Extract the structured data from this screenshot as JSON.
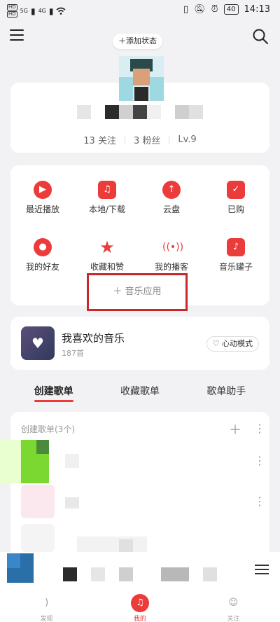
{
  "status_bar": {
    "hd1": "HD",
    "hd2": "HD",
    "sig1": "5G",
    "sig2": "4G",
    "battery": "40",
    "time": "14:13"
  },
  "header": {
    "add_status_label": "＋添加状态"
  },
  "profile": {
    "following": "13 关注",
    "followers": "3 粉丝",
    "level": "Lv.9"
  },
  "apps": {
    "row1": [
      {
        "label": "最近播放",
        "icon": "play-icon"
      },
      {
        "label": "本地/下载",
        "icon": "music-folder-icon"
      },
      {
        "label": "云盘",
        "icon": "cloud-upload-icon"
      },
      {
        "label": "已购",
        "icon": "bag-check-icon"
      }
    ],
    "row2": [
      {
        "label": "我的好友",
        "icon": "people-icon"
      },
      {
        "label": "收藏和赞",
        "icon": "star-icon"
      },
      {
        "label": "我的播客",
        "icon": "podcast-icon"
      },
      {
        "label": "音乐罐子",
        "icon": "music-jar-icon"
      }
    ],
    "music_app_label": "＋ 音乐应用"
  },
  "favorite": {
    "title": "我喜欢的音乐",
    "count": "187首",
    "heart_mode_label": "心动模式"
  },
  "tabs": [
    {
      "label": "创建歌单",
      "active": true
    },
    {
      "label": "收藏歌单",
      "active": false
    },
    {
      "label": "歌单助手",
      "active": false
    }
  ],
  "playlists": {
    "header": "创建歌单(3个)"
  },
  "bottom_nav": [
    {
      "label": "发现",
      "active": false
    },
    {
      "label": "我的",
      "active": true
    },
    {
      "label": "关注",
      "active": false
    }
  ],
  "colors": {
    "accent": "#ec3b3b",
    "highlight_border": "#c8272c"
  }
}
